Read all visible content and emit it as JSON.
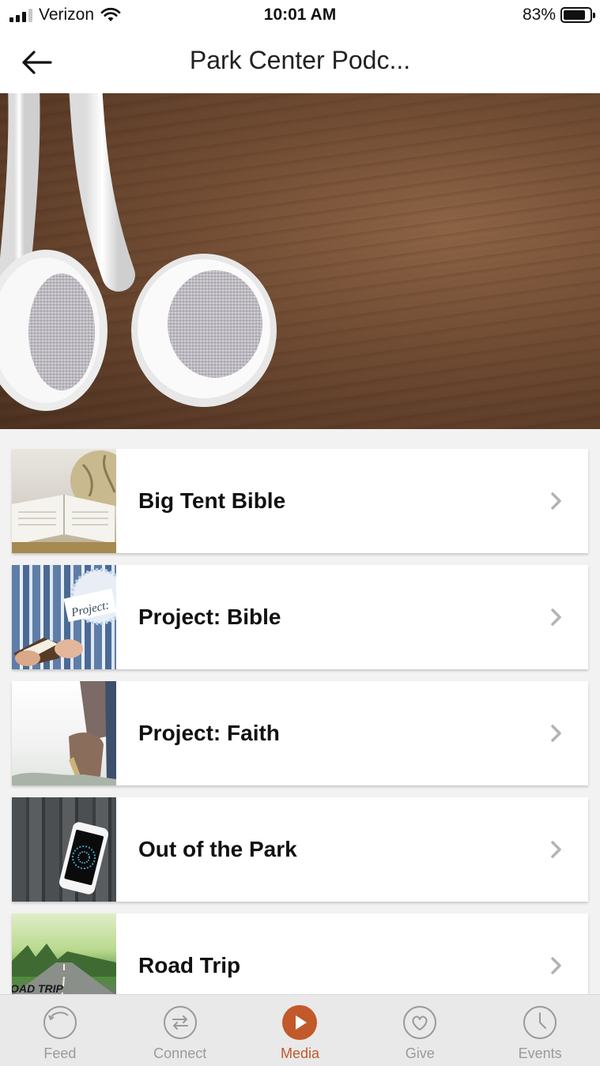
{
  "status_bar": {
    "carrier": "Verizon",
    "time": "10:01 AM",
    "battery_percent": "83%",
    "battery_level": 0.83
  },
  "nav": {
    "title": "Park Center Podc...",
    "back_icon": "arrow-left-icon"
  },
  "hero": {
    "image": "earbuds-on-wood-photo"
  },
  "podcasts": [
    {
      "title": "Big Tent Bible",
      "thumbnail": "open-bible-and-globe-photo"
    },
    {
      "title": "Project: Bible",
      "thumbnail": "man-holding-bible-photo"
    },
    {
      "title": "Project: Faith",
      "thumbnail": "person-holding-shoe-photo"
    },
    {
      "title": "Out of the Park",
      "thumbnail": "phone-on-wood-photo"
    },
    {
      "title": "Road Trip",
      "thumbnail": "road-landscape-photo"
    }
  ],
  "tabs": [
    {
      "label": "Feed",
      "icon": "feed-icon",
      "active": false
    },
    {
      "label": "Connect",
      "icon": "connect-icon",
      "active": false
    },
    {
      "label": "Media",
      "icon": "play-icon",
      "active": true
    },
    {
      "label": "Give",
      "icon": "heart-icon",
      "active": false
    },
    {
      "label": "Events",
      "icon": "clock-icon",
      "active": false
    }
  ],
  "colors": {
    "accent": "#c1592a",
    "tab_inactive": "#9a9a9a"
  },
  "thumbnail_texts": {
    "project_bible_sign": "Project:",
    "road_trip_caption": "OAD TRIP"
  }
}
